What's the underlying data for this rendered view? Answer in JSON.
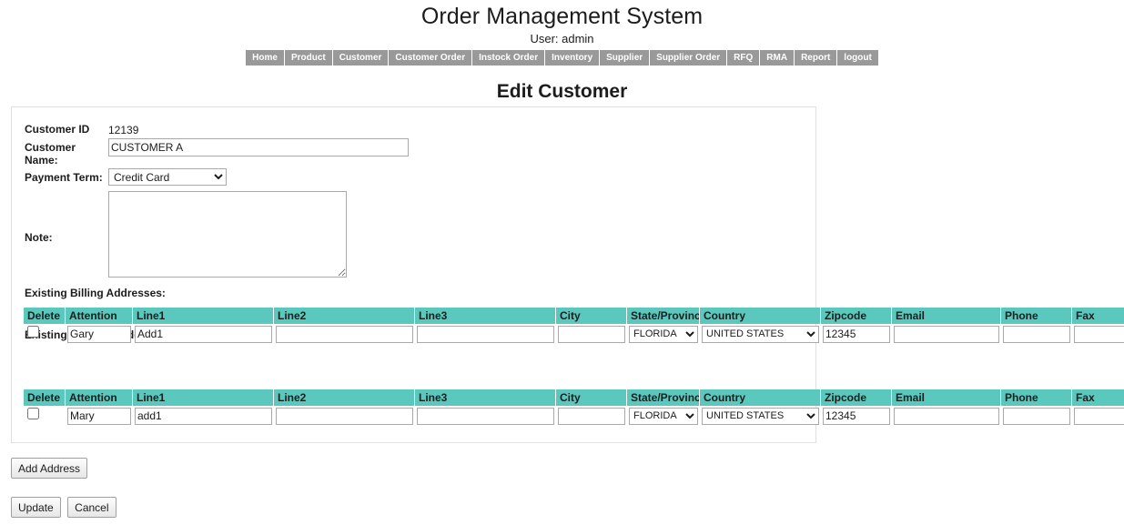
{
  "header": {
    "app_title": "Order Management System",
    "user_line": "User: admin",
    "nav_items": [
      {
        "label": "Home"
      },
      {
        "label": "Product"
      },
      {
        "label": "Customer"
      },
      {
        "label": "Customer Order"
      },
      {
        "label": "Instock Order"
      },
      {
        "label": "Inventory"
      },
      {
        "label": "Supplier"
      },
      {
        "label": "Supplier Order"
      },
      {
        "label": "RFQ"
      },
      {
        "label": "RMA"
      },
      {
        "label": "Report"
      },
      {
        "label": "logout"
      }
    ]
  },
  "page": {
    "title": "Edit Customer"
  },
  "form": {
    "customer_id_label": "Customer ID",
    "customer_id_value": "12139",
    "customer_name_label": "Customer Name:",
    "customer_name_value": "CUSTOMER A",
    "payment_term_label": "Payment Term:",
    "payment_term_value": "Credit Card",
    "payment_term_options": [
      "Credit Card"
    ],
    "note_label": "Note:",
    "note_value": "",
    "note_placeholder": ""
  },
  "billing": {
    "section_label": "Existing Billing Addresses:",
    "columns": [
      "Delete",
      "Attention",
      "Line1",
      "Line2",
      "Line3",
      "City",
      "State/Province",
      "Country",
      "Zipcode",
      "Email",
      "Phone",
      "Fax"
    ],
    "rows": [
      {
        "delete_checked": false,
        "attention": "Gary",
        "line1": "Add1",
        "line2": "",
        "line3": "",
        "city": "",
        "state": "FLORIDA",
        "country": "UNITED STATES",
        "zipcode": "12345",
        "email": "",
        "phone": "",
        "fax": ""
      }
    ]
  },
  "shipping": {
    "section_label": "Existing Shipping Addresses:",
    "columns": [
      "Delete",
      "Attention",
      "Line1",
      "Line2",
      "Line3",
      "City",
      "State/Province",
      "Country",
      "Zipcode",
      "Email",
      "Phone",
      "Fax"
    ],
    "rows": [
      {
        "delete_checked": false,
        "attention": "Mary",
        "line1": "add1",
        "line2": "",
        "line3": "",
        "city": "",
        "state": "FLORIDA",
        "country": "UNITED STATES",
        "zipcode": "12345",
        "email": "",
        "phone": "",
        "fax": ""
      }
    ]
  },
  "actions": {
    "add_address": "Add Address",
    "update": "Update",
    "cancel": "Cancel"
  },
  "colors": {
    "nav_bg": "#999999",
    "table_header": "#5bc8bd",
    "text": "#1c1c1c"
  }
}
